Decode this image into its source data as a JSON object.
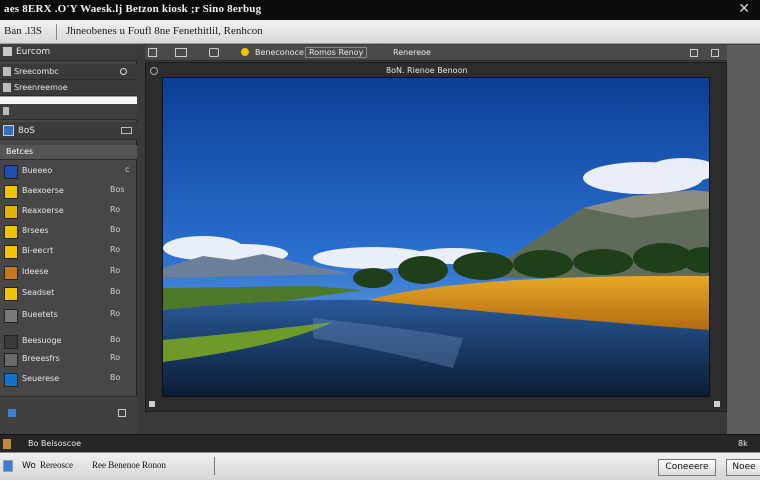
{
  "window": {
    "title": "aes 8ERX .O'Y Waesk.lj  Betzon kiosk ;r Sino 8erbug",
    "menubar_app": "Ban .l3S",
    "menubar_title": "Jhneobenes u Foufl 8ne Fenethitlil, Renhcon"
  },
  "left_panel": {
    "header": "Eurcom",
    "row1_label": "Sreecombc",
    "row2_label": "Sreenreemoe",
    "section_label": "8oS",
    "layers_header": "Betces",
    "layers": [
      {
        "label": "Bueeeo",
        "value": "c",
        "color": "#1f4fb0"
      },
      {
        "label": "Baexoerse",
        "value": "Bos",
        "color": "#f0c400"
      },
      {
        "label": "Reaxoerse",
        "value": "Ro",
        "color": "#e2b400"
      },
      {
        "label": "8rsees",
        "value": "Bo",
        "color": "#f0c400"
      },
      {
        "label": "Bi-eecrt",
        "value": "Ro",
        "color": "#f0c400"
      },
      {
        "label": "Ideese",
        "value": "Ro",
        "color": "#c6771a"
      },
      {
        "label": "Seadset",
        "value": "Bo",
        "color": "#f0c400"
      },
      {
        "label": "Bueetets",
        "value": "Ro",
        "color": "#7a7a7a"
      },
      {
        "label": "Beesuoge",
        "value": "Bo",
        "color": "#3a3a3a"
      },
      {
        "label": "Breeesfrs",
        "value": "Ro",
        "color": "#6a6a6a"
      },
      {
        "label": "Seuerese",
        "value": "Bo",
        "color": "#0e73c9"
      }
    ]
  },
  "toolbar": {
    "item1": "Beneconoce",
    "item2": "Romos Renoy",
    "item3": "Renereoe",
    "canvas_label": "8oN. Rienoe Benoon"
  },
  "statusbar": {
    "left": "Bo Beisoscoe",
    "right": "8k"
  },
  "bottombar": {
    "field_label": "Wo",
    "field_value": "Rereosce",
    "field_value2": "Ree  Benenoe Ronon",
    "button1": "Coneeere",
    "button2": "Noee"
  }
}
